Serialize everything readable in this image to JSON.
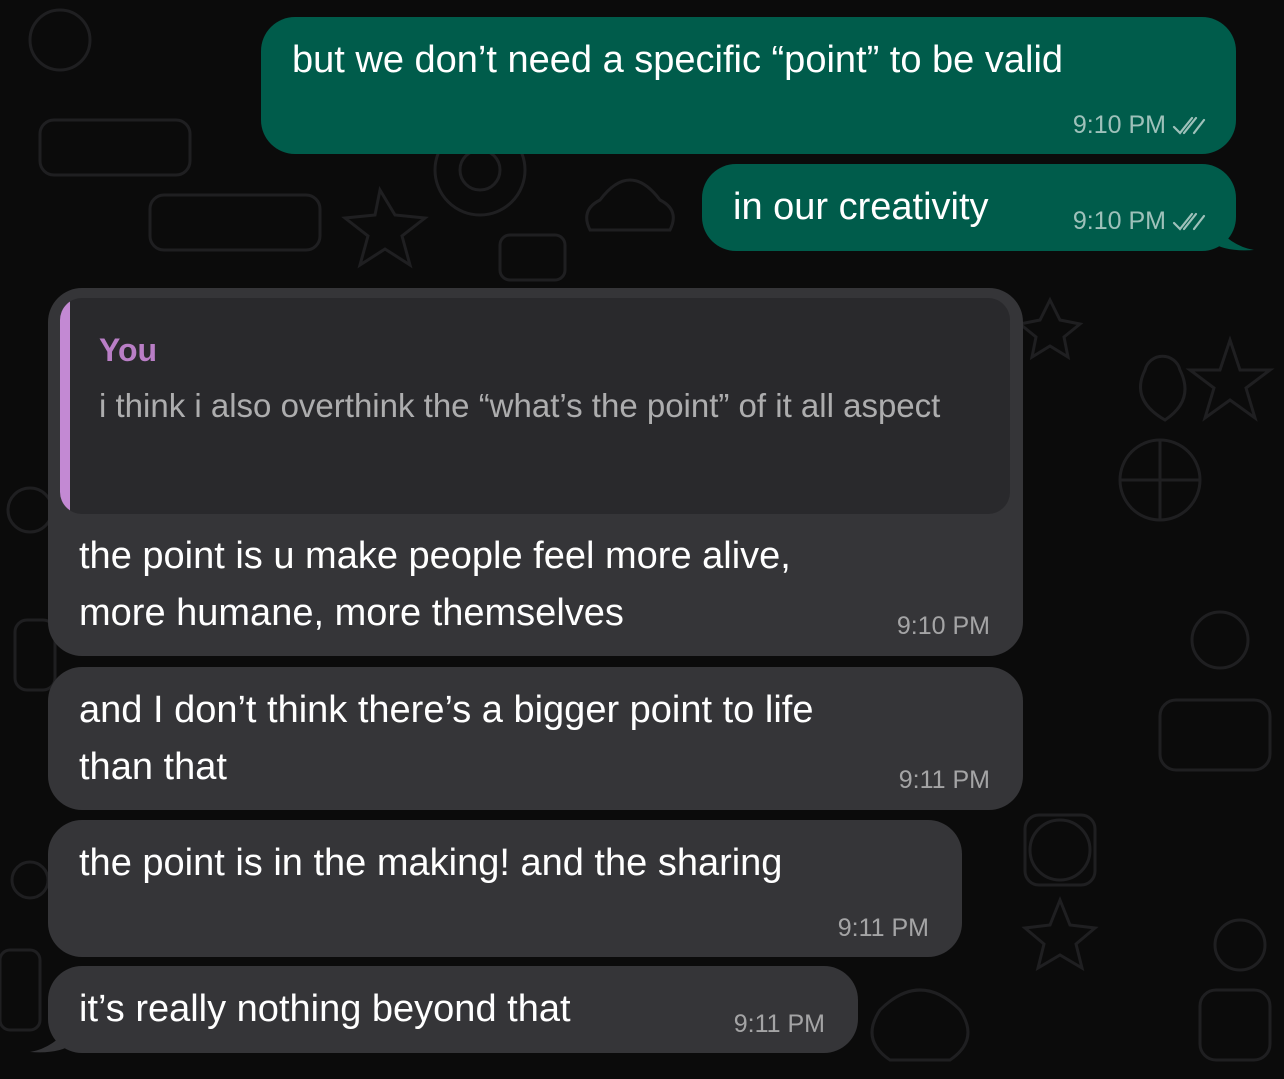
{
  "conversation": {
    "outgoing": [
      {
        "text": "but we don’t need a specific “point” to be valid",
        "time": "9:10 PM",
        "status_icon": "double-check-icon"
      },
      {
        "text": "in our creativity",
        "time": "9:10 PM",
        "status_icon": "double-check-icon"
      }
    ],
    "incoming": [
      {
        "quote": {
          "author": "You",
          "text": "i think i also overthink the “what’s the point” of it all aspect"
        },
        "lines": [
          "the point is u make people feel more alive,",
          "more humane, more themselves"
        ],
        "time": "9:10 PM"
      },
      {
        "lines": [
          "and I don’t think there’s a bigger point to life",
          "than that"
        ],
        "time": "9:11 PM"
      },
      {
        "lines": [
          "the point is in the making! and the sharing"
        ],
        "time": "9:11 PM"
      },
      {
        "lines": [
          "it’s really nothing beyond that"
        ],
        "time": "9:11 PM"
      }
    ]
  },
  "colors": {
    "background": "#0b0b0b",
    "outgoing_bubble": "#005c4b",
    "incoming_bubble": "#353538",
    "quote_background": "#29292c",
    "quote_accent": "#c389d3",
    "quote_author": "#b97ec6"
  }
}
